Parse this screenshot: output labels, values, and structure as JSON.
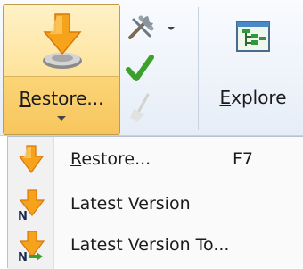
{
  "ribbon": {
    "restore_button": {
      "label_underlined": "R",
      "label_rest": "estore...",
      "icon": "restore-arrow-icon"
    },
    "small_buttons": [
      {
        "icon": "tools-icon",
        "has_dropdown": true
      },
      {
        "icon": "checkmark-icon"
      },
      {
        "icon": "broom-icon",
        "disabled": true
      }
    ],
    "explore_button": {
      "label_underlined": "E",
      "label_rest": "xplore",
      "icon": "explore-tree-icon"
    }
  },
  "menu": {
    "items": [
      {
        "icon": "restore-arrow-icon",
        "label_underlined": "R",
        "label_rest": "estore...",
        "shortcut": "F7"
      },
      {
        "icon": "latest-version-icon",
        "label_underlined": "",
        "label_rest": "Latest Version",
        "shortcut": ""
      },
      {
        "icon": "latest-version-to-icon",
        "label_underlined": "",
        "label_rest": "Latest Version To...",
        "shortcut": ""
      }
    ]
  },
  "colors": {
    "accent_orange": "#f7a21b",
    "active_button_gold": "#fbd577",
    "check_green": "#3ca12b"
  }
}
